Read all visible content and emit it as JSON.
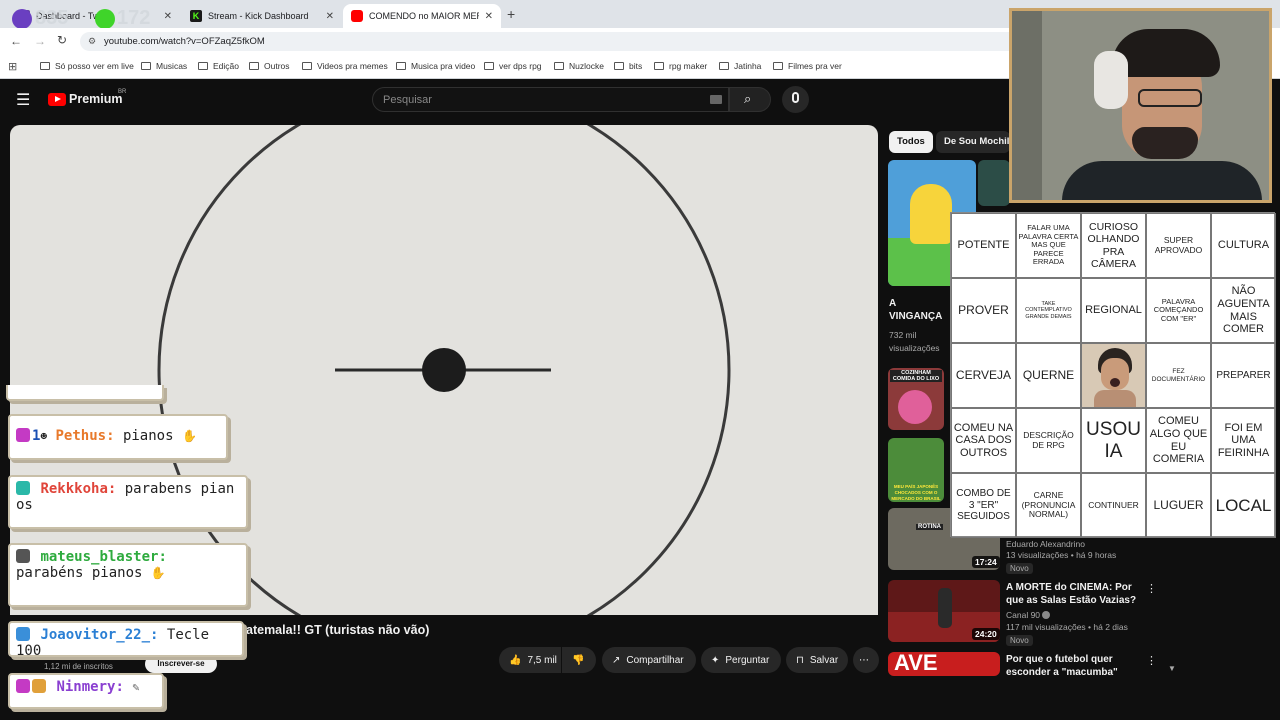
{
  "browser": {
    "tabs": [
      {
        "title": "Dashboard - Twitch",
        "favicon_color": "#6441a5"
      },
      {
        "title": "Stream - Kick Dashboard",
        "favicon_color": "#1a1a1a"
      },
      {
        "title": "COMENDO no MAIOR MERCADO",
        "favicon_color": "#ff0000"
      }
    ],
    "new_tab_symbol": "+",
    "url": "youtube.com/watch?v=OFZaqZ5fkOM",
    "bookmarks": [
      "Só posso ver em live",
      "Musicas",
      "Edição",
      "Outros",
      "Videos pra memes",
      "Musica pra video",
      "ver dps rpg",
      "Nuzlocke",
      "bits",
      "rpg maker",
      "Jatinha",
      "Filmes pra ver"
    ],
    "overlay_counters": [
      "835",
      "172"
    ]
  },
  "youtube": {
    "logo_text": "Premium",
    "logo_sup": "BR",
    "search_placeholder": "Pesquisar",
    "video_title_visible": "atemala!! GT (turistas não vão)",
    "subscribers": "1,12 mi de inscritos",
    "subscribe_label": "Inscrever-se",
    "actions": {
      "likes": "7,5 mil",
      "share": "Compartilhar",
      "ask": "Perguntar",
      "save": "Salvar"
    },
    "chips": [
      "Todos",
      "De Sou Mochileiro"
    ],
    "recommended": [
      {
        "title": "A VINGANÇA CONTRA ...",
        "views": "732 mil",
        "meta2": "visualizações"
      },
      {
        "thumb_text": "COZINHAM COMIDA DO LIXO"
      },
      {
        "thumb_text": "MEU PAÍS JAPONÊS CHOCADOS COM O MERCADO DO BRASIL"
      },
      {
        "channel": "Eduardo Alexandrino",
        "meta": "13 visualizações • há 9 horas",
        "badge": "Novo",
        "duration": "17:24",
        "thumb_text": "ROTINA"
      },
      {
        "title": "A MORTE do CINEMA: Por que as Salas Estão Vazias?",
        "channel": "Canal 90",
        "meta": "117 mil visualizações • há 2 dias",
        "badge": "Novo",
        "duration": "24:20"
      },
      {
        "title": "Por que o futebol quer esconder a \"macumba\"",
        "thumb_text": "AVE"
      }
    ]
  },
  "bingo": {
    "cells": [
      "POTENTE",
      "FALAR UMA PALAVRA CERTA MAS QUE PARECE ERRADA",
      "CURIOSO OLHANDO PRA CÂMERA",
      "SUPER APROVADO",
      "CULTURA",
      "PROVER",
      "TAKE CONTEMPLATIVO GRANDE DEMAIS",
      "REGIONAL",
      "PALAVRA COMEÇANDO COM \"ER\"",
      "NÃO AGUENTA MAIS COMER",
      "CERVEJA",
      "QUERNE",
      "",
      "FEZ DOCUMENTÁRIO",
      "PREPARER",
      "COMEU NA CASA DOS OUTROS",
      "DESCRIÇÃO DE RPG",
      "USOU IA",
      "COMEU ALGO QUE EU COMERIA",
      "FOI EM UMA FEIRINHA",
      "COMBO DE 3 \"ER\" SEGUIDOS",
      "CARNE (PRONUNCIA NORMAL)",
      "CONTINUER",
      "LUGUER",
      "LOCAL"
    ]
  },
  "chat": [
    {
      "user": "Pethus:",
      "text": "pianos",
      "user_color": "#e8792b",
      "badge_num": "1"
    },
    {
      "user": "Rekkkoha:",
      "text": "parabens pian os",
      "user_color": "#e0453a"
    },
    {
      "user": "mateus_blaster:",
      "text": "parabéns pianos",
      "user_color": "#2eab3e"
    },
    {
      "user": "Joaovitor_22_:",
      "text": "Tecle 100",
      "user_color": "#2a7fd4"
    },
    {
      "user": "Ninmery:",
      "text": "",
      "user_color": "#8a3fd1"
    }
  ]
}
